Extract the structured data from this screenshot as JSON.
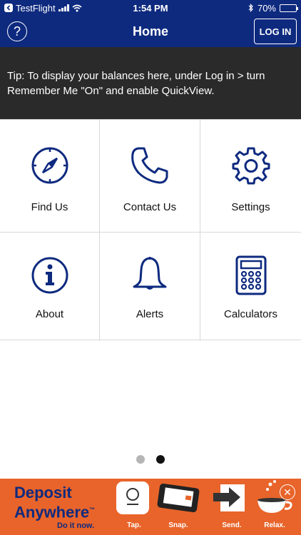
{
  "status_bar": {
    "back_app": "TestFlight",
    "time": "1:54 PM",
    "battery": "70%",
    "battery_level": 0.7
  },
  "nav": {
    "title": "Home",
    "help_symbol": "?",
    "login_label": "LOG IN"
  },
  "tip": {
    "text": "Tip: To display your balances here, under Log in > turn Remember Me \"On\" and enable QuickView."
  },
  "tiles": [
    {
      "label": "Find Us",
      "icon": "compass-icon"
    },
    {
      "label": "Contact Us",
      "icon": "phone-icon"
    },
    {
      "label": "Settings",
      "icon": "gear-icon"
    },
    {
      "label": "About",
      "icon": "info-icon"
    },
    {
      "label": "Alerts",
      "icon": "bell-icon"
    },
    {
      "label": "Calculators",
      "icon": "calculator-icon"
    }
  ],
  "pager": {
    "pages": 2,
    "current": 2
  },
  "ad": {
    "brand_line1": "Deposit",
    "brand_line2": "Anywhere",
    "trademark": "™",
    "cta": "Do it now.",
    "steps": [
      "Tap.",
      "Snap.",
      "Send.",
      "Relax."
    ],
    "close_symbol": "✕"
  },
  "colors": {
    "nav": "#0e2a7f",
    "tip_bg": "#2a2a2a",
    "icon": "#0e2a7f",
    "ad_bg": "#e8642a"
  }
}
